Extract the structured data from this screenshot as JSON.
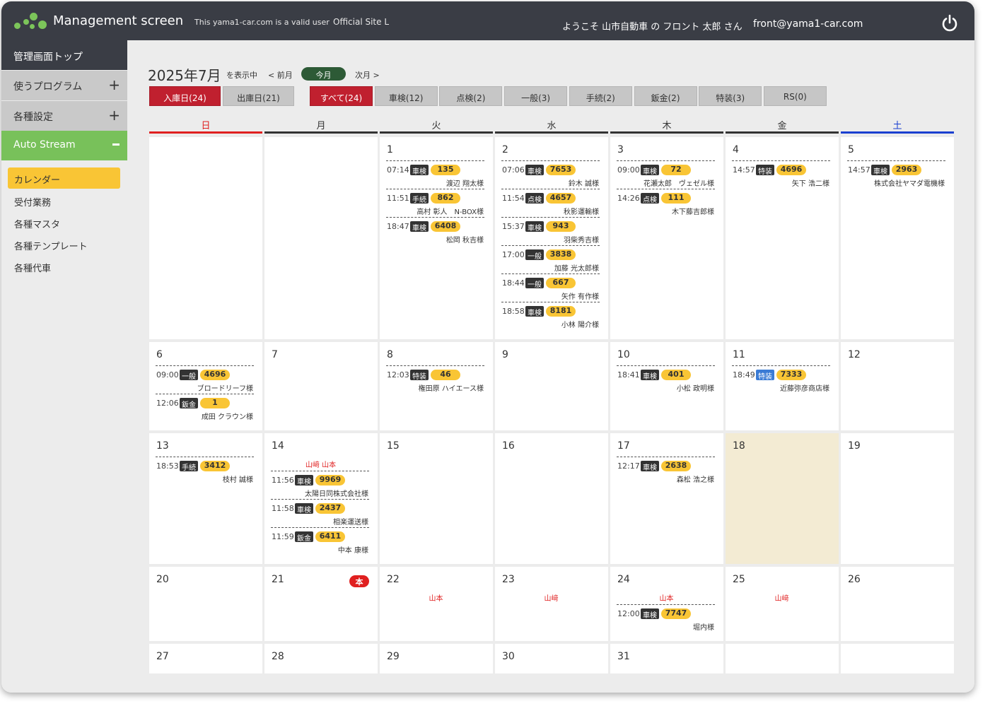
{
  "header": {
    "app_title": "Management screen",
    "valid_user": "This yama1-car.com is a valid user",
    "official_site": "Official Site L",
    "welcome": "ようこそ 山市自動車 の フロント 太郎 さん",
    "email": "front@yama1-car.com"
  },
  "sidebar": {
    "top": "管理画面トップ",
    "programs": "使うプログラム",
    "settings": "各種設定",
    "auto_stream": "Auto Stream",
    "sub_items": [
      "カレンダー",
      "受付業務",
      "各種マスタ",
      "各種テンプレート",
      "各種代車"
    ]
  },
  "calendar": {
    "month": "2025年7月",
    "showing": "を表示中",
    "prev": "< 前月",
    "today": "今月",
    "next": "次月 >",
    "date_filters": [
      "入庫日(24)",
      "出庫日(21)"
    ],
    "type_filters": [
      "すべて(24)",
      "車検(12)",
      "点検(2)",
      "一般(3)",
      "手続(2)",
      "鈑金(2)",
      "特装(3)",
      "RS(0)"
    ],
    "weekdays": [
      "日",
      "月",
      "火",
      "水",
      "木",
      "金",
      "土"
    ],
    "colors": {
      "sunday": "#e02020",
      "saturday": "#1a3fd0",
      "accent_yellow": "#f9c535",
      "active_red": "#c0202f",
      "green": "#78c15a"
    },
    "days": {
      "1": {
        "events": [
          {
            "time": "07:14",
            "type": "車検",
            "num": "135",
            "customer": "渡辺 翔太様"
          },
          {
            "time": "11:51",
            "type": "手続",
            "num": "862",
            "customer": "高村 彰人　N-BOX様"
          },
          {
            "time": "18:47",
            "type": "車検",
            "num": "6408",
            "customer": "松岡 秋吉様"
          }
        ]
      },
      "2": {
        "events": [
          {
            "time": "07:06",
            "type": "車検",
            "num": "7653",
            "customer": "鈴木 誠様"
          },
          {
            "time": "11:54",
            "type": "点検",
            "num": "4657",
            "customer": "秋影運輸様"
          },
          {
            "time": "15:37",
            "type": "車検",
            "num": "943",
            "customer": "羽柴秀吉様"
          },
          {
            "time": "17:00",
            "type": "一般",
            "num": "3838",
            "customer": "加藤 光太郎様"
          },
          {
            "time": "18:44",
            "type": "一般",
            "num": "667",
            "customer": "矢作 有作様"
          },
          {
            "time": "18:58",
            "type": "車検",
            "num": "8181",
            "customer": "小林 陽介様"
          }
        ]
      },
      "3": {
        "events": [
          {
            "time": "09:00",
            "type": "車検",
            "num": "72",
            "customer": "花瀬太郎　ヴェゼル様"
          },
          {
            "time": "14:26",
            "type": "点検",
            "num": "111",
            "customer": "木下藤吉郎様"
          }
        ]
      },
      "4": {
        "events": [
          {
            "time": "14:57",
            "type": "特装",
            "num": "4696",
            "customer": "矢下 浩二様"
          }
        ]
      },
      "5": {
        "events": [
          {
            "time": "14:57",
            "type": "車検",
            "num": "2963",
            "customer": "株式会社ヤマダ電機様"
          }
        ]
      },
      "6": {
        "events": [
          {
            "time": "09:00",
            "type": "一般",
            "num": "4696",
            "customer": "ブロードリーフ様"
          },
          {
            "time": "12:06",
            "type": "鈑金",
            "num": "1",
            "customer": "成田 クラウン様"
          }
        ]
      },
      "8": {
        "events": [
          {
            "time": "12:03",
            "type": "特装",
            "num": "46",
            "customer": "権田原 ハイエース様"
          }
        ]
      },
      "10": {
        "events": [
          {
            "time": "18:41",
            "type": "車検",
            "num": "401",
            "customer": "小松 政明様"
          }
        ]
      },
      "11": {
        "events": [
          {
            "time": "18:49",
            "type": "特装",
            "num": "7333",
            "customer": "近藤弥彦商店様"
          }
        ]
      },
      "13": {
        "events": [
          {
            "time": "18:53",
            "type": "手続",
            "num": "3412",
            "customer": "枝村 誠様"
          }
        ]
      },
      "14": {
        "staff": "山﨑 山本",
        "events": [
          {
            "time": "11:56",
            "type": "車検",
            "num": "9969",
            "customer": "太陽日同株式会社様"
          },
          {
            "time": "11:58",
            "type": "車検",
            "num": "2437",
            "customer": "相楽運送様"
          },
          {
            "time": "11:59",
            "type": "鈑金",
            "num": "6411",
            "customer": "中本 康様"
          }
        ]
      },
      "17": {
        "events": [
          {
            "time": "12:17",
            "type": "車検",
            "num": "2638",
            "customer": "森松 浩之様"
          }
        ]
      },
      "21": {
        "holiday": "本"
      },
      "22": {
        "staff": "山本"
      },
      "23": {
        "staff": "山﨑"
      },
      "24": {
        "staff": "山本",
        "events": [
          {
            "time": "12:00",
            "type": "車検",
            "num": "7747",
            "customer": "堀内様"
          }
        ]
      },
      "25": {
        "staff": "山﨑"
      }
    }
  }
}
